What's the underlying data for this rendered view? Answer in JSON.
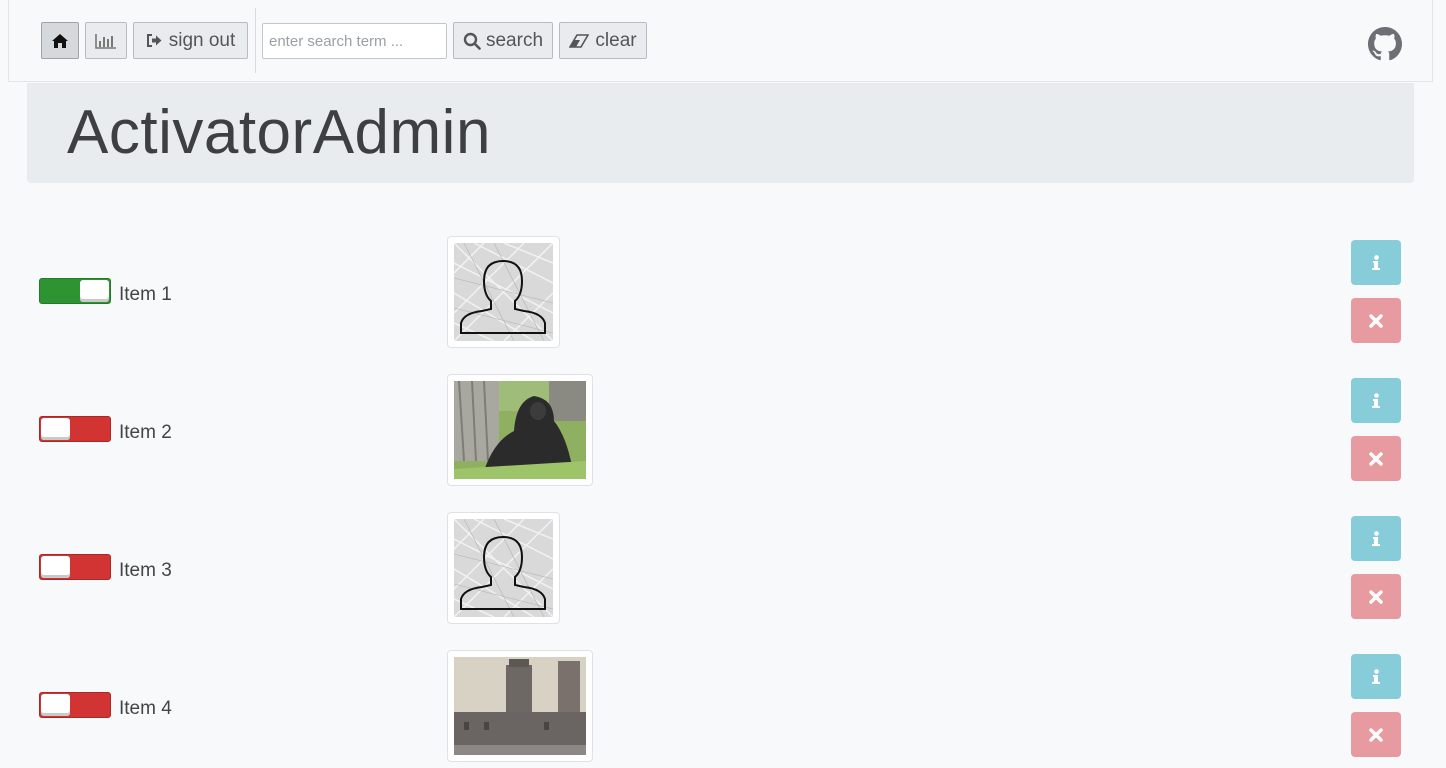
{
  "navbar": {
    "home_icon": "home-icon",
    "stats_icon": "bar-chart-icon",
    "signout_label": "sign out",
    "search_placeholder": "enter search term ...",
    "search_label": "search",
    "clear_label": "clear",
    "github_icon": "github-icon"
  },
  "header": {
    "title": "ActivatorAdmin"
  },
  "items": [
    {
      "label": "Item 1",
      "active": true,
      "image": "avatar-placeholder"
    },
    {
      "label": "Item 2",
      "active": false,
      "image": "gorilla-photo"
    },
    {
      "label": "Item 3",
      "active": false,
      "image": "avatar-placeholder"
    },
    {
      "label": "Item 4",
      "active": false,
      "image": "castle-photo"
    }
  ],
  "colors": {
    "toggle_on": "#2e9431",
    "toggle_off": "#d23434",
    "info_button": "#87ccd9",
    "delete_button": "#e89aa1"
  }
}
